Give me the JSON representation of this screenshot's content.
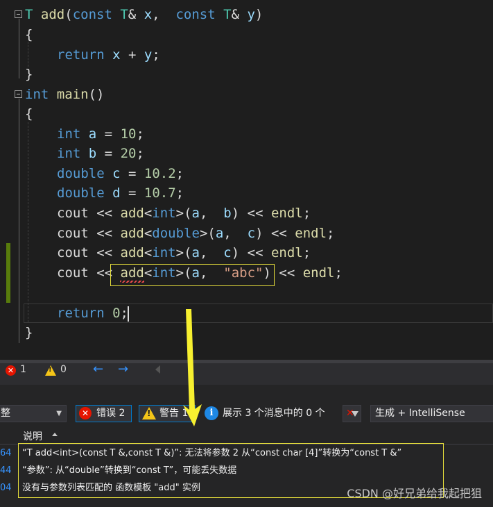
{
  "editor": {
    "lines": [
      {
        "tokens": [
          {
            "c": "ty",
            "t": "T"
          },
          {
            "c": "plain",
            "t": " "
          },
          {
            "c": "fn",
            "t": "add"
          },
          {
            "c": "plain",
            "t": "("
          },
          {
            "c": "kw",
            "t": "const"
          },
          {
            "c": "plain",
            "t": " "
          },
          {
            "c": "ty",
            "t": "T"
          },
          {
            "c": "plain",
            "t": "& "
          },
          {
            "c": "var",
            "t": "x"
          },
          {
            "c": "plain",
            "t": ",  "
          },
          {
            "c": "kw",
            "t": "const"
          },
          {
            "c": "plain",
            "t": " "
          },
          {
            "c": "ty",
            "t": "T"
          },
          {
            "c": "plain",
            "t": "& "
          },
          {
            "c": "var",
            "t": "y"
          },
          {
            "c": "plain",
            "t": ")"
          }
        ]
      },
      {
        "tokens": [
          {
            "c": "plain",
            "t": "{"
          }
        ]
      },
      {
        "tokens": [
          {
            "c": "kw",
            "t": "return"
          },
          {
            "c": "plain",
            "t": " "
          },
          {
            "c": "var",
            "t": "x"
          },
          {
            "c": "plain",
            "t": " + "
          },
          {
            "c": "var",
            "t": "y"
          },
          {
            "c": "plain",
            "t": ";"
          }
        ]
      },
      {
        "tokens": [
          {
            "c": "plain",
            "t": "}"
          }
        ]
      },
      {
        "tokens": [
          {
            "c": "kw",
            "t": "int"
          },
          {
            "c": "plain",
            "t": " "
          },
          {
            "c": "fn",
            "t": "main"
          },
          {
            "c": "plain",
            "t": "()"
          }
        ]
      },
      {
        "tokens": [
          {
            "c": "plain",
            "t": "{"
          }
        ]
      },
      {
        "tokens": [
          {
            "c": "kw",
            "t": "int"
          },
          {
            "c": "plain",
            "t": " "
          },
          {
            "c": "var",
            "t": "a"
          },
          {
            "c": "plain",
            "t": " = "
          },
          {
            "c": "num",
            "t": "10"
          },
          {
            "c": "plain",
            "t": ";"
          }
        ]
      },
      {
        "tokens": [
          {
            "c": "kw",
            "t": "int"
          },
          {
            "c": "plain",
            "t": " "
          },
          {
            "c": "var",
            "t": "b"
          },
          {
            "c": "plain",
            "t": " = "
          },
          {
            "c": "num",
            "t": "20"
          },
          {
            "c": "plain",
            "t": ";"
          }
        ]
      },
      {
        "tokens": [
          {
            "c": "kw",
            "t": "double"
          },
          {
            "c": "plain",
            "t": " "
          },
          {
            "c": "var",
            "t": "c"
          },
          {
            "c": "plain",
            "t": " = "
          },
          {
            "c": "num",
            "t": "10.2"
          },
          {
            "c": "plain",
            "t": ";"
          }
        ]
      },
      {
        "tokens": [
          {
            "c": "kw",
            "t": "double"
          },
          {
            "c": "plain",
            "t": " "
          },
          {
            "c": "var",
            "t": "d"
          },
          {
            "c": "plain",
            "t": " = "
          },
          {
            "c": "num",
            "t": "10.7"
          },
          {
            "c": "plain",
            "t": ";"
          }
        ]
      },
      {
        "tokens": [
          {
            "c": "plain",
            "t": "cout << "
          },
          {
            "c": "fn",
            "t": "add"
          },
          {
            "c": "plain",
            "t": "<"
          },
          {
            "c": "kw",
            "t": "int"
          },
          {
            "c": "plain",
            "t": ">("
          },
          {
            "c": "var",
            "t": "a"
          },
          {
            "c": "plain",
            "t": ",  "
          },
          {
            "c": "var",
            "t": "b"
          },
          {
            "c": "plain",
            "t": ") << "
          },
          {
            "c": "fn",
            "t": "endl"
          },
          {
            "c": "plain",
            "t": ";"
          }
        ]
      },
      {
        "tokens": [
          {
            "c": "plain",
            "t": "cout << "
          },
          {
            "c": "fn",
            "t": "add"
          },
          {
            "c": "plain",
            "t": "<"
          },
          {
            "c": "kw",
            "t": "double"
          },
          {
            "c": "plain",
            "t": ">("
          },
          {
            "c": "var",
            "t": "a"
          },
          {
            "c": "plain",
            "t": ",  "
          },
          {
            "c": "var",
            "t": "c"
          },
          {
            "c": "plain",
            "t": ") << "
          },
          {
            "c": "fn",
            "t": "endl"
          },
          {
            "c": "plain",
            "t": ";"
          }
        ]
      },
      {
        "tokens": [
          {
            "c": "plain",
            "t": "cout << "
          },
          {
            "c": "fn",
            "t": "add"
          },
          {
            "c": "plain",
            "t": "<"
          },
          {
            "c": "kw",
            "t": "int"
          },
          {
            "c": "plain",
            "t": ">("
          },
          {
            "c": "var",
            "t": "a"
          },
          {
            "c": "plain",
            "t": ",  "
          },
          {
            "c": "var",
            "t": "c"
          },
          {
            "c": "plain",
            "t": ") << "
          },
          {
            "c": "fn",
            "t": "endl"
          },
          {
            "c": "plain",
            "t": ";"
          }
        ]
      },
      {
        "tokens": [
          {
            "c": "plain",
            "t": "cout << "
          },
          {
            "c": "fn",
            "t": "add"
          },
          {
            "c": "plain",
            "t": "<"
          },
          {
            "c": "kw",
            "t": "int"
          },
          {
            "c": "plain",
            "t": ">("
          },
          {
            "c": "var",
            "t": "a"
          },
          {
            "c": "plain",
            "t": ",  "
          },
          {
            "c": "str",
            "t": "\"abc\""
          },
          {
            "c": "plain",
            "t": ") << "
          },
          {
            "c": "fn",
            "t": "endl"
          },
          {
            "c": "plain",
            "t": ";"
          }
        ]
      },
      {
        "tokens": []
      },
      {
        "tokens": [
          {
            "c": "kw",
            "t": "return"
          },
          {
            "c": "plain",
            "t": " "
          },
          {
            "c": "num",
            "t": "0"
          },
          {
            "c": "plain",
            "t": ";"
          }
        ]
      },
      {
        "tokens": [
          {
            "c": "plain",
            "t": "}"
          }
        ]
      }
    ]
  },
  "status": {
    "error_count": "1",
    "warning_count": "0"
  },
  "error_list": {
    "scope_value": "整",
    "errors_label": "错误 2",
    "warnings_label": "警告 1",
    "messages_label": "展示 3 个消息中的 0 个",
    "build_filter": "生成 + IntelliSense",
    "column_header": "说明",
    "rows": [
      {
        "num": "64",
        "text": "“T add<int>(const T &,const T &)”: 无法将参数 2 从“const char [4]”转换为“const T &”"
      },
      {
        "num": "44",
        "text": "“参数”: 从“double”转换到“const T”，可能丢失数据"
      },
      {
        "num": "04",
        "text": "没有与参数列表匹配的 函数模板 \"add\" 实例"
      }
    ]
  },
  "watermark": "CSDN @好兄弟给我起把狙",
  "colors": {
    "keyword": "#569cd6",
    "type": "#4ec9b0",
    "number": "#b5cea8",
    "string": "#d69d85",
    "highlight": "#e6de3b",
    "error": "#e51400",
    "warning": "#f5c518"
  }
}
